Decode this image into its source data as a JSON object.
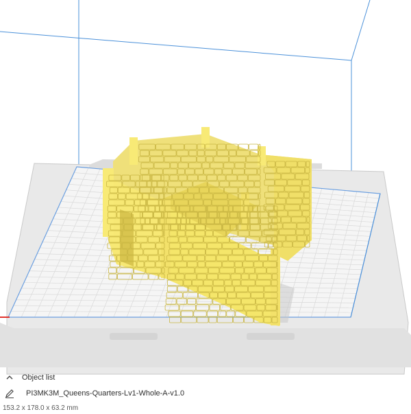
{
  "viewport": {
    "colors": {
      "background": "#ffffff",
      "build_volume_edges": "#4a90d9",
      "plate_surface": "#f3f3f3",
      "plate_grid": "#d6d6d6",
      "plate_edge": "#6b9fe0",
      "model": "#f5e66a",
      "model_shadow": "#cdbd3f",
      "x_axis": "#e0322c"
    },
    "icons": [
      "chevron-up-icon",
      "pencil-icon"
    ]
  },
  "object_list": {
    "header_label": "Object list",
    "file_name": "PI3MK3M_Queens-Quarters-Lv1-Whole-A-v1.0",
    "dimensions": "153.2 x 178.0 x 63.2 mm"
  }
}
